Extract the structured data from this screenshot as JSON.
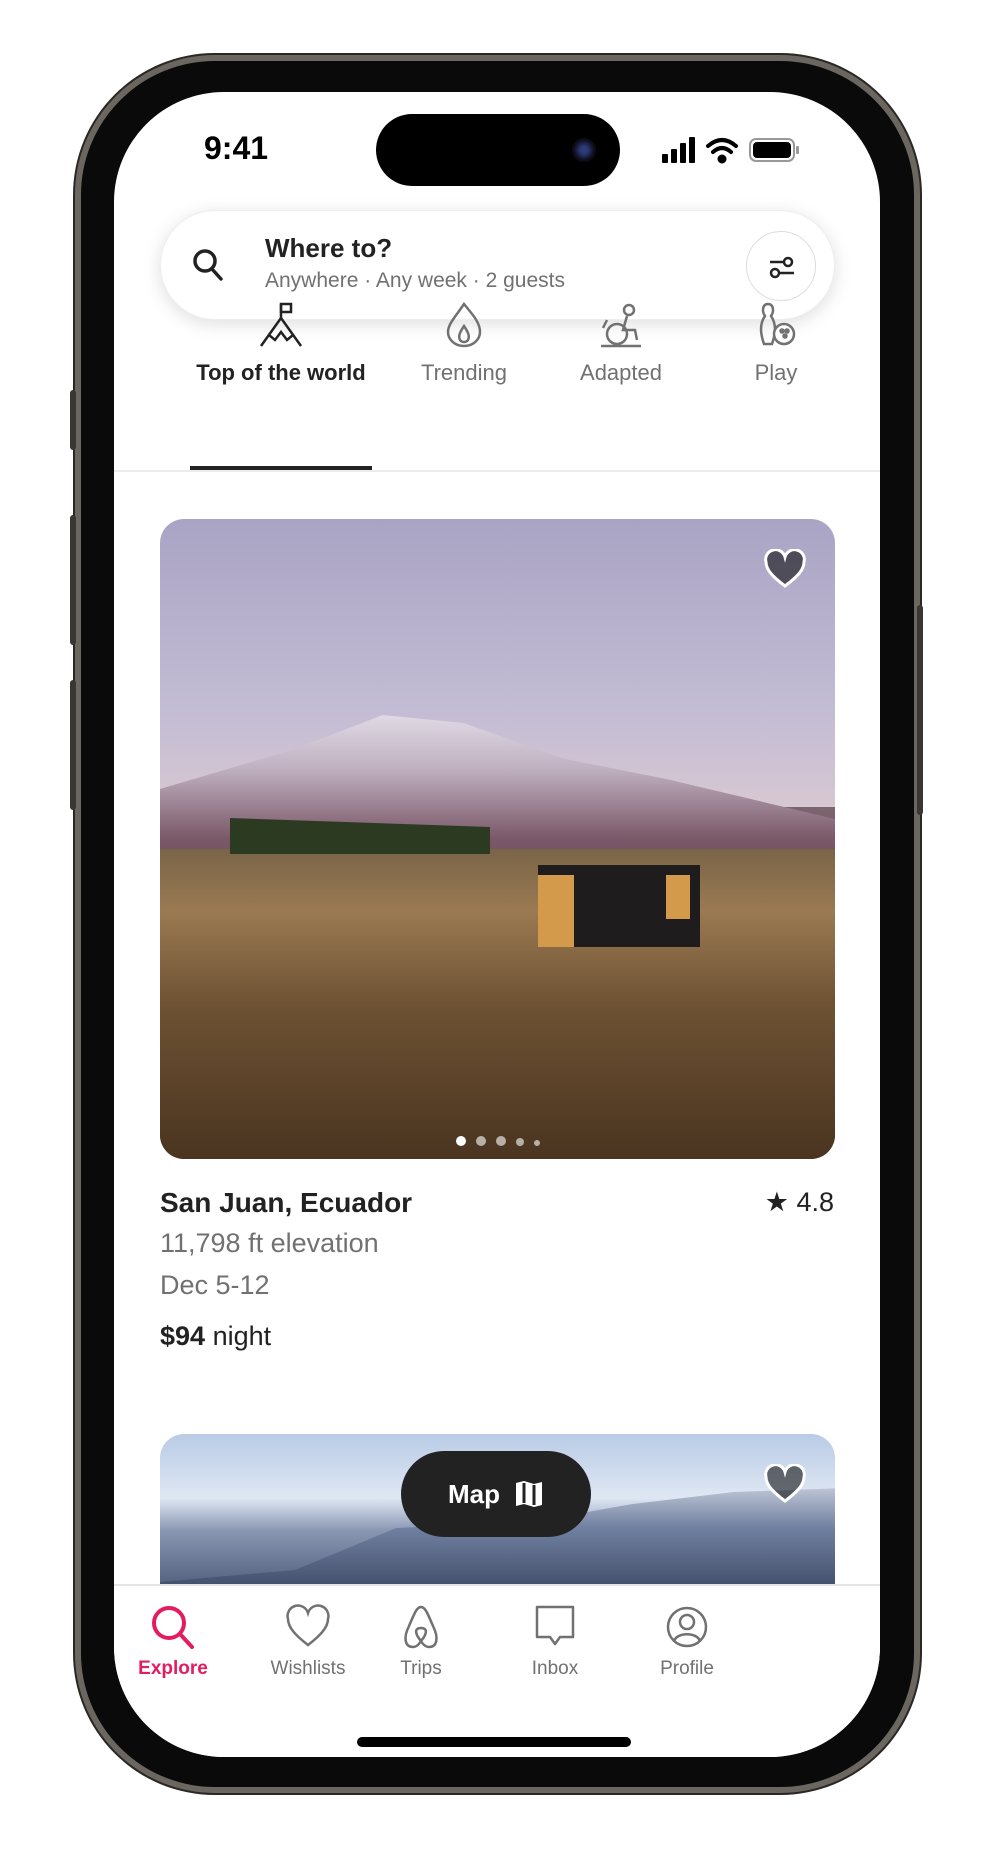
{
  "status": {
    "time": "9:41"
  },
  "search": {
    "title": "Where to?",
    "subtitle": "Anywhere · Any week · 2 guests"
  },
  "categories": [
    {
      "label": "Top of the world",
      "icon": "mountain-flag-icon",
      "active": true
    },
    {
      "label": "Trending",
      "icon": "flame-icon"
    },
    {
      "label": "Adapted",
      "icon": "wheelchair-icon"
    },
    {
      "label": "Play",
      "icon": "bowling-icon"
    }
  ],
  "listing": {
    "location": "San Juan, Ecuador",
    "rating": "4.8",
    "elevation": "11,798 ft elevation",
    "dates": "Dec 5-12",
    "price": "$94",
    "price_unit": " night",
    "photo_count": 5,
    "photo_index": 1
  },
  "map_button": {
    "label": "Map"
  },
  "tabs": [
    {
      "label": "Explore",
      "icon": "search-icon",
      "active": true
    },
    {
      "label": "Wishlists",
      "icon": "heart-icon"
    },
    {
      "label": "Trips",
      "icon": "airbnb-logo-icon"
    },
    {
      "label": "Inbox",
      "icon": "message-icon"
    },
    {
      "label": "Profile",
      "icon": "profile-icon"
    }
  ],
  "colors": {
    "accent": "#e31c5f",
    "text": "#222222",
    "muted": "#717171"
  }
}
